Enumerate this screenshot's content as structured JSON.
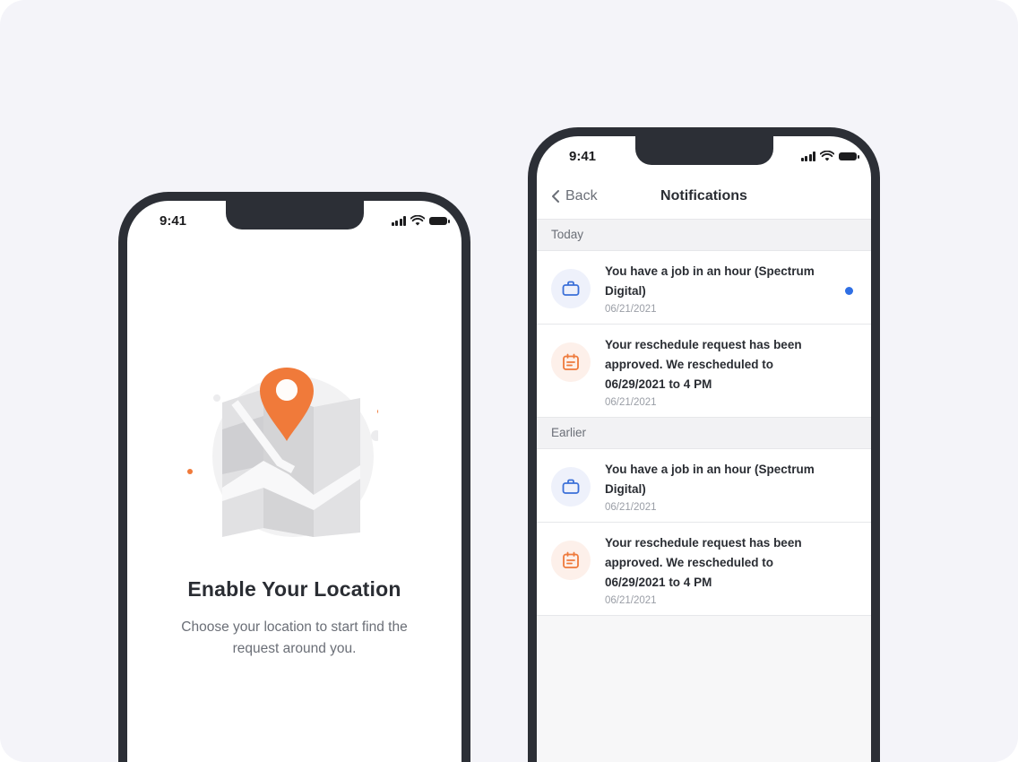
{
  "colors": {
    "background": "#f4f4f9",
    "phone_frame": "#2c2f36",
    "accent_orange": "#f07a3a",
    "accent_blue": "#2f6fe4"
  },
  "location_screen": {
    "status_time": "9:41",
    "title": "Enable Your Location",
    "subtitle": "Choose your location to start find the request around you."
  },
  "notifications_screen": {
    "status_time": "9:41",
    "back_label": "Back",
    "title": "Notifications",
    "sections": [
      {
        "label": "Today",
        "items": [
          {
            "icon": "briefcase-icon",
            "text": "You have a job in an hour (Spectrum Digital)",
            "date": "06/21/2021",
            "unread": true
          },
          {
            "icon": "calendar-icon",
            "text": "Your reschedule request has been approved. We rescheduled to 06/29/2021 to 4 PM",
            "date": "06/21/2021",
            "unread": false
          }
        ]
      },
      {
        "label": "Earlier",
        "items": [
          {
            "icon": "briefcase-icon",
            "text": "You have a job in an hour (Spectrum Digital)",
            "date": "06/21/2021",
            "unread": false
          },
          {
            "icon": "calendar-icon",
            "text": "Your reschedule request has been approved. We rescheduled to 06/29/2021 to 4 PM",
            "date": "06/21/2021",
            "unread": false
          }
        ]
      }
    ]
  }
}
